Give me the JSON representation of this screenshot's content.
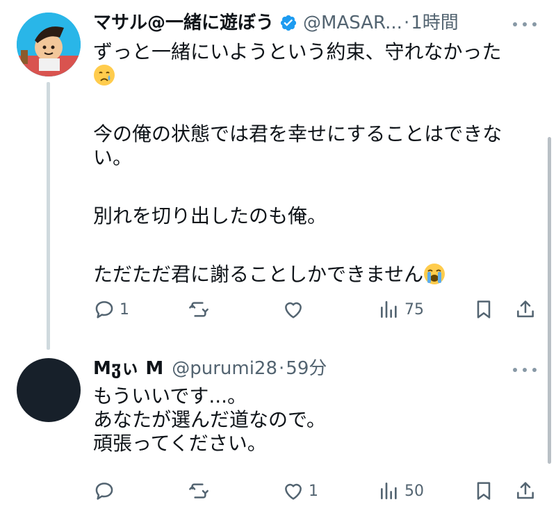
{
  "colors": {
    "text": "#0f1419",
    "secondary": "#536471",
    "verified": "#1d9bf0",
    "icon": "#536471"
  },
  "tweets": [
    {
      "display_name": "マサル@一緒に遊ぼう",
      "verified_icon": "verified-badge-icon",
      "handle": "@MASAR...",
      "separator": "·",
      "time": "1時間",
      "paragraphs": [
        "ずっと一緒にいようという約束、守れなかった",
        "今の俺の状態では君を幸せにすることはできない。",
        "別れを切り出したのも俺。",
        "ただただ君に謝ることしかできません"
      ],
      "emojis": [
        "crying-face-emoji",
        "loudly-crying-face-emoji"
      ],
      "actions": {
        "replies": "1",
        "retweets": "",
        "likes": "",
        "views": "75"
      }
    },
    {
      "display_name": "Mჳぃ M",
      "handle": "@purumi28",
      "separator": "·",
      "time": "59分",
      "paragraphs": [
        "もういいです...。",
        "あなたが選んだ道なので。",
        "頑張ってください。"
      ],
      "actions": {
        "replies": "",
        "retweets": "",
        "likes": "1",
        "views": "50"
      }
    }
  ]
}
